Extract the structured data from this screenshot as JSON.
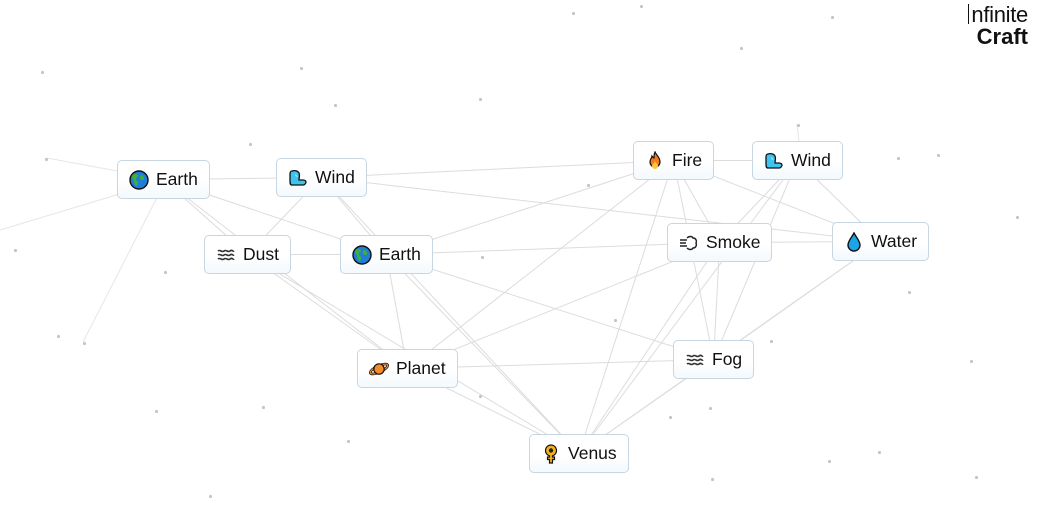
{
  "logo": {
    "line1": "nfinite",
    "line2": "Craft"
  },
  "items": [
    {
      "id": "earth-1",
      "label": "Earth",
      "icon": "earth-globe-icon"
    },
    {
      "id": "wind-1",
      "label": "Wind",
      "icon": "wind-face-icon"
    },
    {
      "id": "dust",
      "label": "Dust",
      "icon": "dust-waves-icon"
    },
    {
      "id": "earth-2",
      "label": "Earth",
      "icon": "earth-globe-icon"
    },
    {
      "id": "fire",
      "label": "Fire",
      "icon": "fire-icon"
    },
    {
      "id": "wind-2",
      "label": "Wind",
      "icon": "wind-face-icon"
    },
    {
      "id": "smoke",
      "label": "Smoke",
      "icon": "smoke-puff-icon"
    },
    {
      "id": "water",
      "label": "Water",
      "icon": "water-drop-icon"
    },
    {
      "id": "planet",
      "label": "Planet",
      "icon": "ringed-planet-icon"
    },
    {
      "id": "fog",
      "label": "Fog",
      "icon": "fog-waves-icon"
    },
    {
      "id": "venus",
      "label": "Venus",
      "icon": "venus-symbol-icon"
    }
  ],
  "connections": [
    [
      "earth-1",
      "wind-1"
    ],
    [
      "earth-1",
      "dust"
    ],
    [
      "earth-1",
      "earth-2"
    ],
    [
      "earth-1",
      "planet"
    ],
    [
      "wind-1",
      "dust"
    ],
    [
      "wind-1",
      "earth-2"
    ],
    [
      "wind-1",
      "fire"
    ],
    [
      "wind-1",
      "venus"
    ],
    [
      "wind-1",
      "water"
    ],
    [
      "dust",
      "earth-2"
    ],
    [
      "dust",
      "planet"
    ],
    [
      "dust",
      "venus"
    ],
    [
      "earth-2",
      "planet"
    ],
    [
      "earth-2",
      "fire"
    ],
    [
      "earth-2",
      "smoke"
    ],
    [
      "earth-2",
      "venus"
    ],
    [
      "earth-2",
      "fog"
    ],
    [
      "fire",
      "wind-2"
    ],
    [
      "fire",
      "smoke"
    ],
    [
      "fire",
      "fog"
    ],
    [
      "fire",
      "water"
    ],
    [
      "fire",
      "planet"
    ],
    [
      "fire",
      "venus"
    ],
    [
      "wind-2",
      "smoke"
    ],
    [
      "wind-2",
      "water"
    ],
    [
      "wind-2",
      "fog"
    ],
    [
      "wind-2",
      "venus"
    ],
    [
      "smoke",
      "water"
    ],
    [
      "smoke",
      "fog"
    ],
    [
      "smoke",
      "venus"
    ],
    [
      "smoke",
      "planet"
    ],
    [
      "water",
      "fog"
    ],
    [
      "water",
      "venus"
    ],
    [
      "planet",
      "fog"
    ],
    [
      "planet",
      "venus"
    ],
    [
      "fog",
      "venus"
    ]
  ]
}
